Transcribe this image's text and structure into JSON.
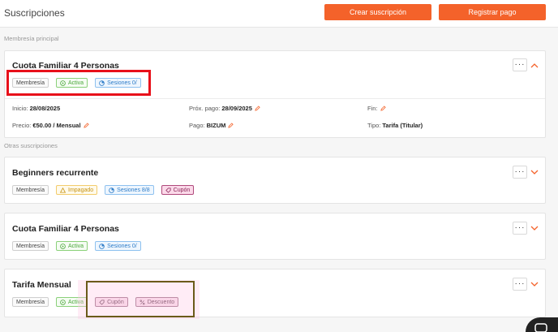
{
  "header": {
    "title": "Suscripciones",
    "create_button": "Crear suscripción",
    "register_button": "Registrar pago"
  },
  "main_section_label": "Membresía principal",
  "others_section_label": "Otras suscripciones",
  "main_card": {
    "title": "Cuota Familiar 4 Personas",
    "tags": [
      "Membresía",
      "Activa",
      "Sesiones 0/"
    ],
    "details": {
      "start_label": "Inicio:",
      "start_value": "28/08/2025",
      "next_label": "Próx. pago:",
      "next_value": "28/09/2025",
      "end_label": "Fin:",
      "price_label": "Precio:",
      "price_value": "€50.00 / Mensual",
      "payment_label": "Pago:",
      "payment_value": "BIZUM",
      "type_label": "Tipo:",
      "type_value": "Tarifa (Titular)"
    }
  },
  "cards": [
    {
      "title": "Beginners recurrente",
      "tags": [
        "Membresía",
        "Impagado",
        "Sesiones 8/8",
        "Cupón"
      ]
    },
    {
      "title": "Cuota Familiar 4 Personas",
      "tags": [
        "Membresía",
        "Activa",
        "Sesiones 0/"
      ]
    },
    {
      "title": "Tarifa Mensual",
      "tags": [
        "Membresía",
        "Activa",
        "Cupón",
        "Descuento"
      ]
    }
  ],
  "kebab_label": "···",
  "colors": {
    "accent": "#f4622a",
    "highlight_red": "#e8101a",
    "highlight_olive": "#6b5a1a"
  }
}
